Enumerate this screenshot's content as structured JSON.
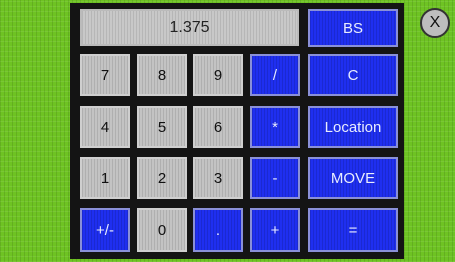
{
  "display": {
    "value": "1.375"
  },
  "keys": {
    "k7": "7",
    "k8": "8",
    "k9": "9",
    "div": "/",
    "k4": "4",
    "k5": "5",
    "k6": "6",
    "mul": "*",
    "k1": "1",
    "k2": "2",
    "k3": "3",
    "sub": "-",
    "sign": "+/-",
    "k0": "0",
    "dot": ".",
    "add": "+",
    "bs": "BS",
    "clear": "C",
    "location": "Location",
    "move": "MOVE",
    "equals": "="
  },
  "close": {
    "label": "X"
  },
  "colors": {
    "background": "#6ec323",
    "gray_key": "#c3c3c3",
    "blue_key": "#1f2ff0",
    "panel": "#141414"
  }
}
